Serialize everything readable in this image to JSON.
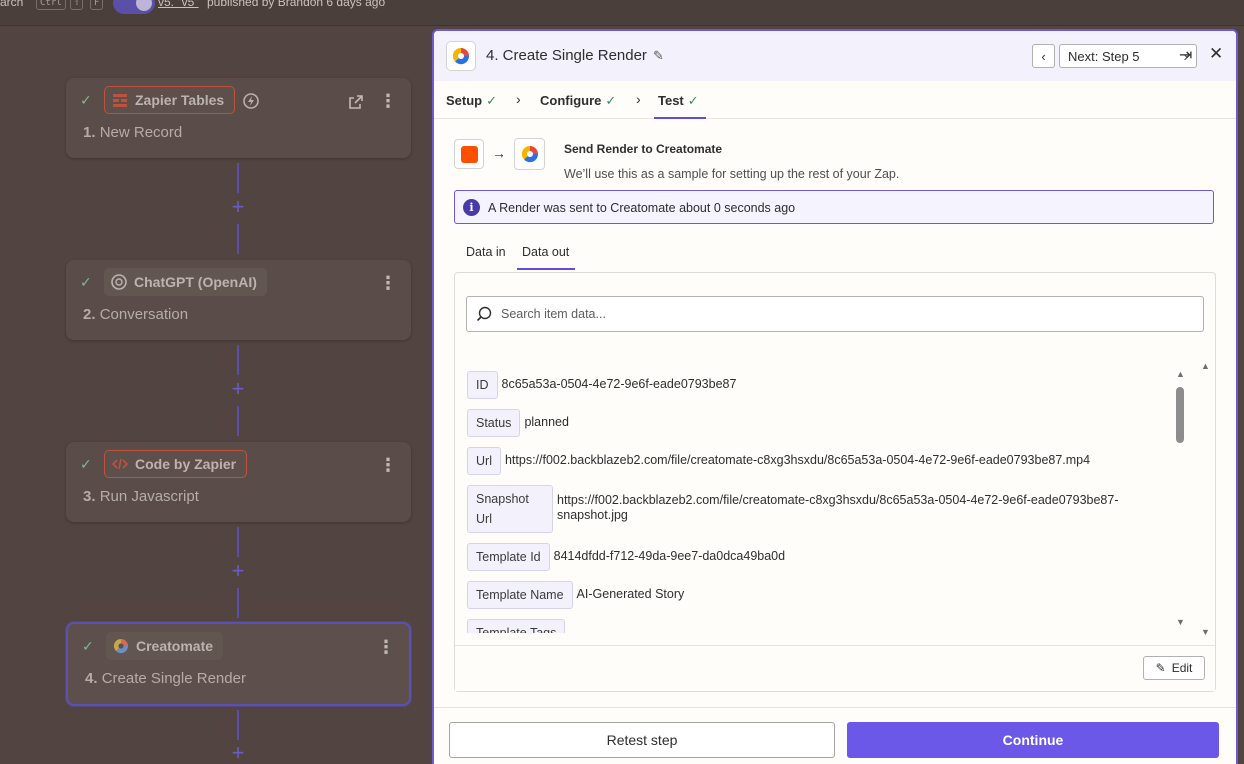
{
  "topbar": {
    "search_text": "arch",
    "kbd_ctrl": "Ctrl",
    "kbd_shift": "⇧",
    "kbd_f": "F",
    "version_link": "v5. \"v5\"",
    "published_text": "published by Brandon 6 days ago"
  },
  "steps": [
    {
      "app": "Zapier Tables",
      "number": "1.",
      "title": "New Record"
    },
    {
      "app": "ChatGPT (OpenAI)",
      "number": "2.",
      "title": "Conversation"
    },
    {
      "app": "Code by Zapier",
      "number": "3.",
      "title": "Run Javascript"
    },
    {
      "app": "Creatomate",
      "number": "4.",
      "title": "Create Single Render"
    }
  ],
  "panel": {
    "title": "4. Create Single Render",
    "next_label": "Next: Step 5",
    "tabs": [
      "Setup",
      "Configure",
      "Test"
    ],
    "send_title": "Send Render to Creatomate",
    "send_subtitle": "We’ll use this as a sample for setting up the rest of your Zap.",
    "info_text": "A Render was sent to Creatomate about 0 seconds ago",
    "data_tabs": [
      "Data in",
      "Data out"
    ],
    "search_placeholder": "Search item data...",
    "rows": [
      {
        "key": "ID",
        "value": "8c65a53a-0504-4e72-9e6f-eade0793be87"
      },
      {
        "key": "Status",
        "value": "planned"
      },
      {
        "key": "Url",
        "value": "https://f002.backblazeb2.com/file/creatomate-c8xg3hsxdu/8c65a53a-0504-4e72-9e6f-eade0793be87.mp4"
      },
      {
        "key": "Snapshot Url",
        "value": "https://f002.backblazeb2.com/file/creatomate-c8xg3hsxdu/8c65a53a-0504-4e72-9e6f-eade0793be87-snapshot.jpg"
      },
      {
        "key": "Template Id",
        "value": "8414dfdd-f712-49da-9ee7-da0dca49ba0d"
      },
      {
        "key": "Template Name",
        "value": "AI-Generated Story"
      },
      {
        "key": "Template Tags",
        "value": ""
      }
    ],
    "edit_label": "Edit",
    "retest_label": "Retest step",
    "continue_label": "Continue"
  },
  "colors": {
    "accent": "#6b57e8",
    "success": "#3c8a56",
    "zapier_orange": "#ff4f00"
  }
}
